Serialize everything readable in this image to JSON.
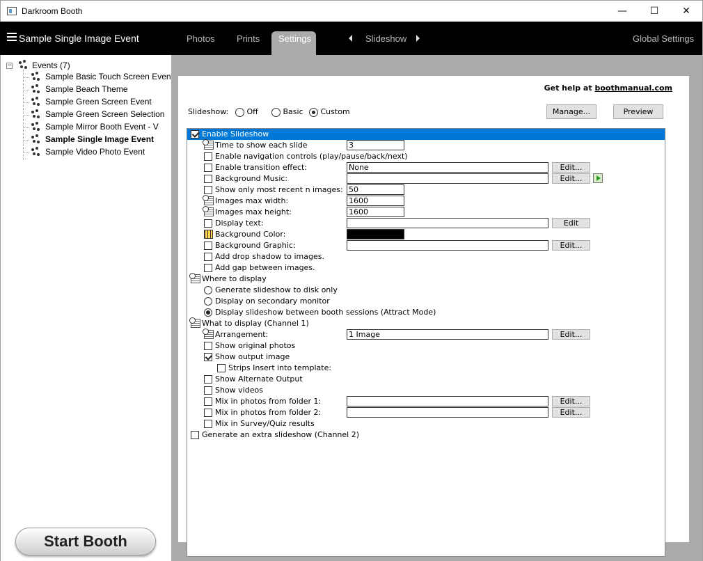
{
  "window": {
    "title": "Darkroom Booth",
    "minimize": "—",
    "maximize": "☐",
    "close": "✕"
  },
  "nav": {
    "event_title": "Sample Single Image Event",
    "tabs": [
      "Photos",
      "Prints",
      "Settings"
    ],
    "active_tab": "Settings",
    "slideshow": "Slideshow",
    "global_settings": "Global Settings"
  },
  "sidebar": {
    "root": "Events (7)",
    "items": [
      "Sample Basic Touch Screen Event",
      "Sample Beach Theme",
      "Sample Green Screen Event",
      "Sample Green Screen Selection",
      "Sample Mirror Booth Event - V",
      "Sample Single Image Event",
      "Sample Video Photo Event"
    ],
    "selected_index": 5,
    "start_button": "Start Booth"
  },
  "panel": {
    "help_text": "Get help at ",
    "help_link": "boothmanual.com",
    "slideshow_label": "Slideshow:",
    "modes": [
      "Off",
      "Basic",
      "Custom"
    ],
    "selected_mode": "Custom",
    "manage_button": "Manage...",
    "preview_button": "Preview",
    "edit_label": "Edit...",
    "edit_label_short": "Edit"
  },
  "props": {
    "enable_slideshow": "Enable Slideshow",
    "time_each_slide": "Time to show each slide",
    "time_each_slide_value": "3",
    "nav_controls": "Enable navigation controls  (play/pause/back/next)",
    "transition": "Enable transition effect:",
    "transition_value": "None",
    "bg_music": "Background Music:",
    "bg_music_value": "",
    "recent_n": "Show only most recent n images:",
    "recent_n_value": "50",
    "max_width": "Images max width:",
    "max_width_value": "1600",
    "max_height": "Images max height:",
    "max_height_value": "1600",
    "display_text": "Display text:",
    "display_text_value": "",
    "bg_color": "Background Color:",
    "bg_color_hex": "#000000",
    "bg_graphic": "Background Graphic:",
    "bg_graphic_value": "",
    "drop_shadow": "Add drop shadow to images.",
    "gap": "Add gap between images.",
    "where_display": "Where to display",
    "gen_disk": "Generate slideshow to disk only",
    "secondary_monitor": "Display on secondary monitor",
    "attract_mode": "Display slideshow between booth sessions (Attract Mode)",
    "what_display": "What to display (Channel 1)",
    "arrangement": "Arrangement:",
    "arrangement_value": "1 Image",
    "show_original": "Show original photos",
    "show_output": "Show output image",
    "strips_insert": "Strips Insert into template:",
    "show_alternate": "Show Alternate Output",
    "show_videos": "Show videos",
    "mix_folder1": "Mix in photos from folder 1:",
    "mix_folder1_value": "",
    "mix_folder2": "Mix in photos from folder 2:",
    "mix_folder2_value": "",
    "mix_survey": "Mix in Survey/Quiz results",
    "extra_slideshow": "Generate an extra slideshow (Channel 2)"
  },
  "colors": {
    "nav_bg": "#000000",
    "main_bg": "#ababab",
    "selection": "#0078d7"
  }
}
